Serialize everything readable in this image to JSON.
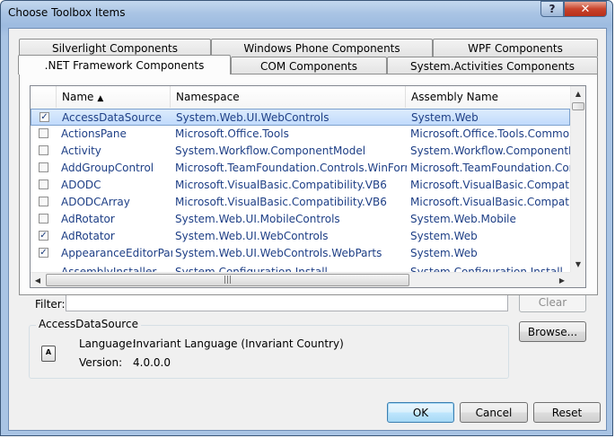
{
  "window": {
    "title": "Choose Toolbox Items",
    "help_glyph": "?",
    "close_glyph": "✕"
  },
  "tabs": {
    "row1": [
      "Silverlight Components",
      "Windows Phone Components",
      "WPF Components"
    ],
    "row2": [
      ".NET Framework Components",
      "COM Components",
      "System.Activities Components"
    ],
    "active": ".NET Framework Components"
  },
  "list": {
    "columns": {
      "name": "Name",
      "namespace": "Namespace",
      "assembly": "Assembly Name"
    },
    "sort_glyph": "▲",
    "rows": [
      {
        "checked": true,
        "name": "AccessDataSource",
        "namespace": "System.Web.UI.WebControls",
        "assembly": "System.Web",
        "selected": true
      },
      {
        "checked": false,
        "name": "ActionsPane",
        "namespace": "Microsoft.Office.Tools",
        "assembly": "Microsoft.Office.Tools.Common.v"
      },
      {
        "checked": false,
        "name": "Activity",
        "namespace": "System.Workflow.ComponentModel",
        "assembly": "System.Workflow.ComponentMo"
      },
      {
        "checked": false,
        "name": "AddGroupControl",
        "namespace": "Microsoft.TeamFoundation.Controls.WinForms",
        "assembly": "Microsoft.TeamFoundation.Contr"
      },
      {
        "checked": false,
        "name": "ADODC",
        "namespace": "Microsoft.VisualBasic.Compatibility.VB6",
        "assembly": "Microsoft.VisualBasic.Compatibili"
      },
      {
        "checked": false,
        "name": "ADODCArray",
        "namespace": "Microsoft.VisualBasic.Compatibility.VB6",
        "assembly": "Microsoft.VisualBasic.Compatibili"
      },
      {
        "checked": false,
        "name": "AdRotator",
        "namespace": "System.Web.UI.MobileControls",
        "assembly": "System.Web.Mobile"
      },
      {
        "checked": true,
        "name": "AdRotator",
        "namespace": "System.Web.UI.WebControls",
        "assembly": "System.Web"
      },
      {
        "checked": true,
        "name": "AppearanceEditorPart",
        "namespace": "System.Web.UI.WebControls.WebParts",
        "assembly": "System.Web"
      },
      {
        "checked": false,
        "name": "AssemblyInstaller",
        "namespace": "System.Configuration.Install",
        "assembly": "System.Configuration.Install"
      }
    ],
    "check_glyph": "✓",
    "hscroll_grip": "|||"
  },
  "filter": {
    "label": "Filter:",
    "value": ""
  },
  "buttons": {
    "clear": "Clear",
    "browse": "Browse...",
    "ok": "OK",
    "cancel": "Cancel",
    "reset": "Reset"
  },
  "details": {
    "group_title": "AccessDataSource",
    "icon_text": "A",
    "language_label": "Language:",
    "language_value": "Invariant Language (Invariant Country)",
    "version_label": "Version:",
    "version_value": "4.0.0.0"
  }
}
